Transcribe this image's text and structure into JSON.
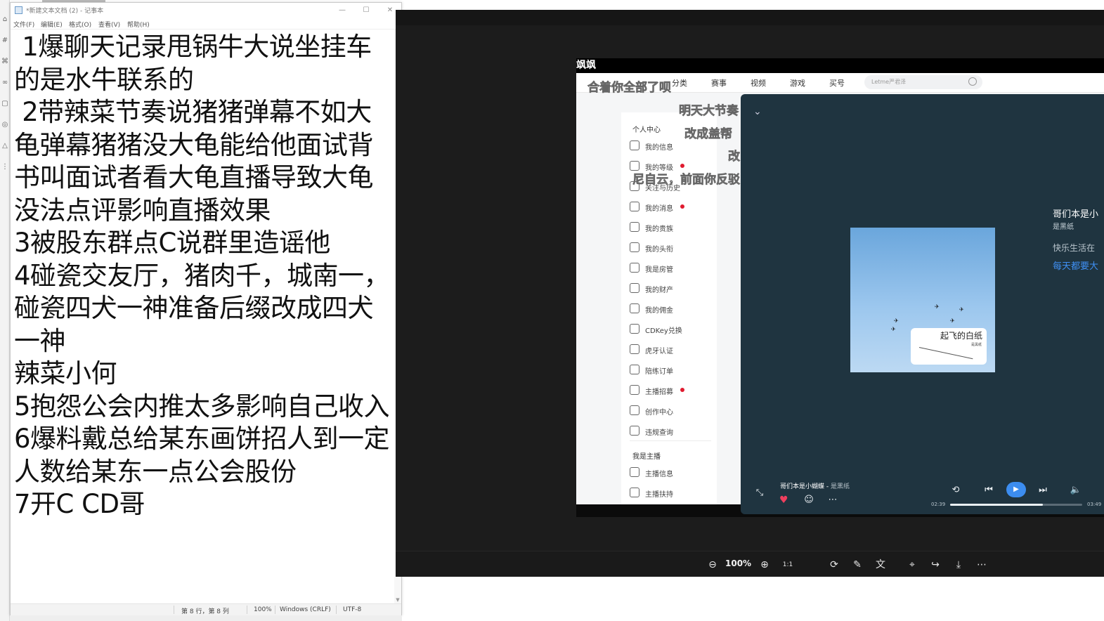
{
  "notepad": {
    "title": "*新建文本文档 (2) - 记事本",
    "menu": [
      "文件(F)",
      "编辑(E)",
      "格式(O)",
      "查看(V)",
      "帮助(H)"
    ],
    "content": " 1爆聊天记录甩锅牛大说坐挂车的是水牛联系的\n 2带辣菜节奏说猪猪弹幕不如大龟弹幕猪猪没大龟能给他面试背书叫面试者看大龟直播导致大龟没法点评影响直播效果\n3被股东群点C说群里造谣他\n4碰瓷交友厅，猪肉千，城南一，碰瓷四犬一神准备后缀改成四犬一神\n辣菜小何\n5抱怨公会内推太多影响自己收入\n6爆料戴总给某东画饼招人到一定人数给某东一点公会股份\n7开C CD哥",
    "status": {
      "position": "第 8 行，第 8 列",
      "zoom": "100%",
      "line_ending": "Windows (CRLF)",
      "encoding": "UTF-8"
    }
  },
  "viewer": {
    "zoom": "100%",
    "toolbar_icons": [
      "zoom-out-icon",
      "zoom-in-icon",
      "actual-size-icon",
      "rotate-icon",
      "edit-icon",
      "translate-icon",
      "ocr-icon",
      "share-icon",
      "download-icon",
      "more-icon"
    ]
  },
  "web": {
    "title": "飒飒",
    "nav": [
      "分类",
      "赛事",
      "视频",
      "游戏",
      "买号"
    ],
    "search_placeholder": "Letme严君泽",
    "sidebar": {
      "section1": "个人中心",
      "items": [
        {
          "label": "我的信息",
          "dot": false
        },
        {
          "label": "我的等级",
          "dot": true
        },
        {
          "label": "关注与历史",
          "dot": false
        },
        {
          "label": "我的消息",
          "dot": true
        },
        {
          "label": "我的贵族",
          "dot": false
        },
        {
          "label": "我的头衔",
          "dot": false
        },
        {
          "label": "我是房管",
          "dot": false
        },
        {
          "label": "我的财产",
          "dot": false
        },
        {
          "label": "我的佣金",
          "dot": false
        },
        {
          "label": "CDKey兑换",
          "dot": false
        },
        {
          "label": "虎牙认证",
          "dot": false
        },
        {
          "label": "陪练订单",
          "dot": false
        },
        {
          "label": "主播招募",
          "dot": true
        },
        {
          "label": "创作中心",
          "dot": false
        },
        {
          "label": "违规查询",
          "dot": false
        }
      ],
      "section2": "我是主播",
      "items2": [
        {
          "label": "主播信息"
        },
        {
          "label": "主播扶持"
        }
      ]
    },
    "danmaku": [
      "合着你全部了呗",
      "明天大节奏",
      "改成盖帮",
      "改",
      "尼自云，前面你反驳"
    ]
  },
  "player": {
    "song": "哥们本是小蝴蝶",
    "artist": "是黑纸",
    "right_title": "哥们本是小",
    "right_artist": "是黑纸",
    "lyric_1": "快乐生活在",
    "lyric_2": "每天都要大",
    "cover_title": "起飞的白纸",
    "cover_sub": "是黑纸",
    "time_current": "02:39",
    "time_total": "03:49",
    "progress": 0.7,
    "colors": {
      "accent": "#3c8df0",
      "heart": "#ef3f5e",
      "background": "#1f3440"
    }
  }
}
